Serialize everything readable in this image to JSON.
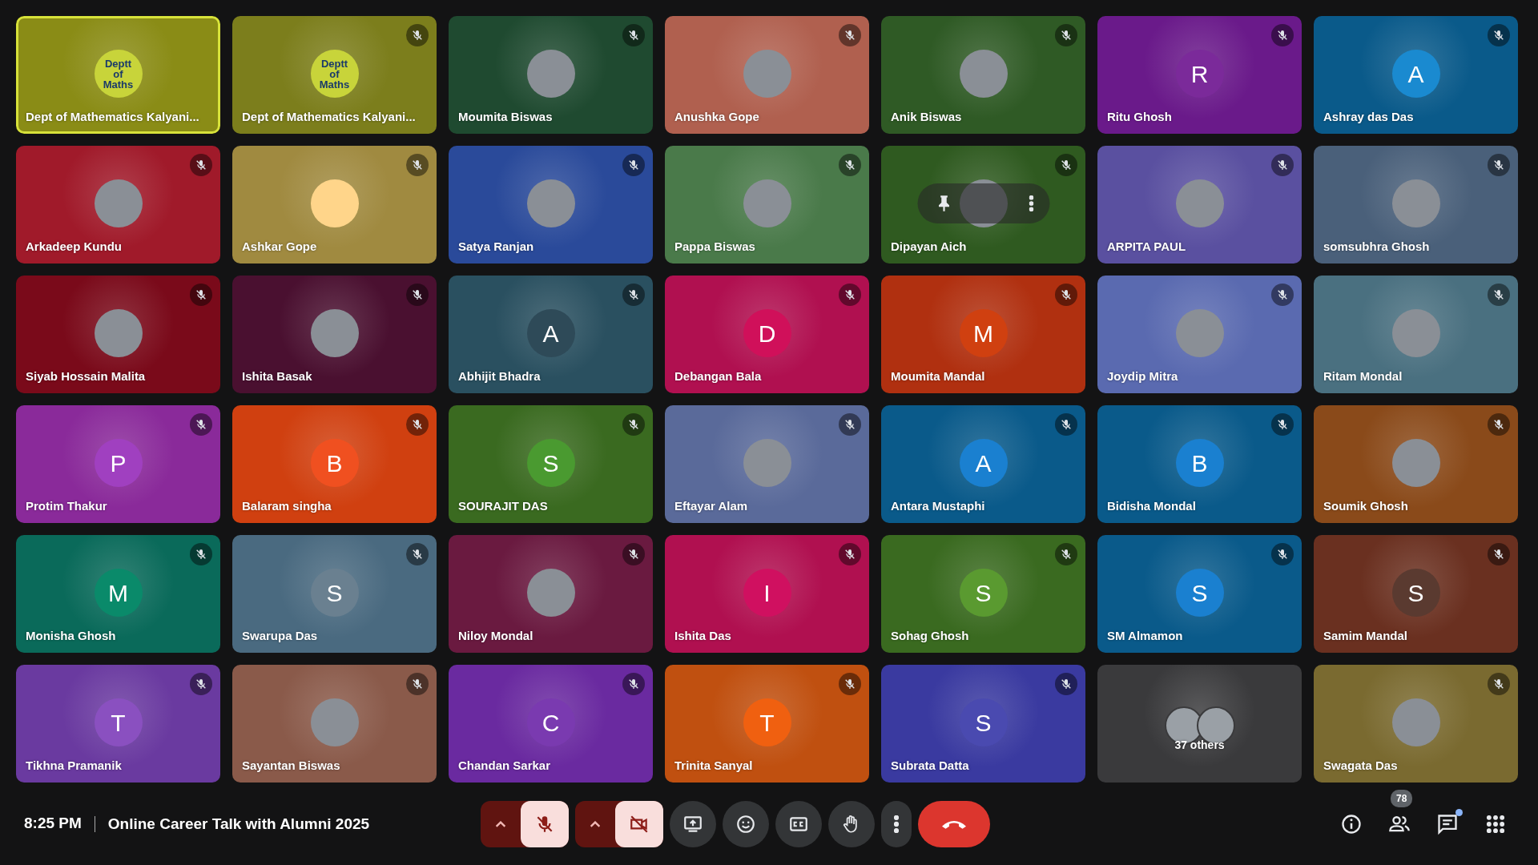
{
  "tiles": [
    {
      "name": "Dept of Mathematics Kalyani...",
      "color": "#8a8c16",
      "avatar": {
        "kind": "logo",
        "text": "Deptt of Maths"
      },
      "muted": false,
      "speaking": true
    },
    {
      "name": "Dept of Mathematics Kalyani...",
      "color": "#7c7e1c",
      "avatar": {
        "kind": "logo",
        "text": "Deptt of Maths"
      },
      "muted": true,
      "speaking": false
    },
    {
      "name": "Moumita Biswas",
      "color": "#1f4a30",
      "avatar": {
        "kind": "photo"
      },
      "muted": true,
      "speaking": false
    },
    {
      "name": "Anushka Gope",
      "color": "#b0604f",
      "avatar": {
        "kind": "photo"
      },
      "muted": true,
      "speaking": false
    },
    {
      "name": "Anik Biswas",
      "color": "#2f5a25",
      "avatar": {
        "kind": "photo"
      },
      "muted": true,
      "speaking": false
    },
    {
      "name": "Ritu Ghosh",
      "color": "#6a1a8a",
      "avatar": {
        "kind": "letter",
        "text": "R",
        "color": "#7b2a9a"
      },
      "muted": true,
      "speaking": false
    },
    {
      "name": "Ashray das Das",
      "color": "#0a5a8a",
      "avatar": {
        "kind": "letter",
        "text": "A",
        "color": "#1a8ad0"
      },
      "muted": true,
      "speaking": false
    },
    {
      "name": "Arkadeep Kundu",
      "color": "#a01a2a",
      "avatar": {
        "kind": "photo"
      },
      "muted": true,
      "speaking": false
    },
    {
      "name": "Ashkar Gope",
      "color": "#a08a40",
      "avatar": {
        "kind": "blank",
        "color": "#ffd58a"
      },
      "muted": true,
      "speaking": false
    },
    {
      "name": "Satya Ranjan",
      "color": "#2a4a9a",
      "avatar": {
        "kind": "photo"
      },
      "muted": true,
      "speaking": false
    },
    {
      "name": "Pappa Biswas",
      "color": "#4a7a4a",
      "avatar": {
        "kind": "photo"
      },
      "muted": true,
      "speaking": false
    },
    {
      "name": "Dipayan Aich",
      "color": "#2f5a20",
      "avatar": {
        "kind": "photo"
      },
      "muted": true,
      "speaking": false,
      "hovered": true
    },
    {
      "name": "ARPITA PAUL",
      "color": "#5a50a0",
      "avatar": {
        "kind": "photo"
      },
      "muted": true,
      "speaking": false
    },
    {
      "name": "somsubhra Ghosh",
      "color": "#4a607a",
      "avatar": {
        "kind": "photo"
      },
      "muted": true,
      "speaking": false
    },
    {
      "name": "Siyab Hossain Malita",
      "color": "#7a0a1a",
      "avatar": {
        "kind": "photo"
      },
      "muted": true,
      "speaking": false
    },
    {
      "name": "Ishita Basak",
      "color": "#4a1030",
      "avatar": {
        "kind": "photo"
      },
      "muted": true,
      "speaking": false
    },
    {
      "name": "Abhijit Bhadra",
      "color": "#2a5060",
      "avatar": {
        "kind": "letter",
        "text": "A",
        "color": "#2e4a58"
      },
      "muted": true,
      "speaking": false
    },
    {
      "name": "Debangan Bala",
      "color": "#b01050",
      "avatar": {
        "kind": "letter",
        "text": "D",
        "color": "#d0105a"
      },
      "muted": true,
      "speaking": false
    },
    {
      "name": "Moumita Mandal",
      "color": "#b03010",
      "avatar": {
        "kind": "letter",
        "text": "M",
        "color": "#d04010"
      },
      "muted": true,
      "speaking": false
    },
    {
      "name": "Joydip Mitra",
      "color": "#5a6ab0",
      "avatar": {
        "kind": "photo"
      },
      "muted": true,
      "speaking": false
    },
    {
      "name": "Ritam Mondal",
      "color": "#4a7080",
      "avatar": {
        "kind": "photo"
      },
      "muted": true,
      "speaking": false
    },
    {
      "name": "Protim Thakur",
      "color": "#8a2a9a",
      "avatar": {
        "kind": "letter",
        "text": "P",
        "color": "#a040c0"
      },
      "muted": true,
      "speaking": false
    },
    {
      "name": "Balaram singha",
      "color": "#d04010",
      "avatar": {
        "kind": "letter",
        "text": "B",
        "color": "#f05020"
      },
      "muted": true,
      "speaking": false
    },
    {
      "name": "SOURAJIT DAS",
      "color": "#3a6a20",
      "avatar": {
        "kind": "letter",
        "text": "S",
        "color": "#4a9a30"
      },
      "muted": true,
      "speaking": false
    },
    {
      "name": "Eftayar Alam",
      "color": "#5a6a9a",
      "avatar": {
        "kind": "photo"
      },
      "muted": true,
      "speaking": false
    },
    {
      "name": "Antara Mustaphi",
      "color": "#0a5a8a",
      "avatar": {
        "kind": "letter",
        "text": "A",
        "color": "#1a80d0"
      },
      "muted": true,
      "speaking": false
    },
    {
      "name": "Bidisha Mondal",
      "color": "#0a5a8a",
      "avatar": {
        "kind": "letter",
        "text": "B",
        "color": "#1a80d0"
      },
      "muted": true,
      "speaking": false
    },
    {
      "name": "Soumik Ghosh",
      "color": "#8a4a1a",
      "avatar": {
        "kind": "photo"
      },
      "muted": true,
      "speaking": false
    },
    {
      "name": "Monisha Ghosh",
      "color": "#0a6a5a",
      "avatar": {
        "kind": "letter",
        "text": "M",
        "color": "#0a8a6a"
      },
      "muted": true,
      "speaking": false
    },
    {
      "name": "Swarupa Das",
      "color": "#4a6a80",
      "avatar": {
        "kind": "letter",
        "text": "S",
        "color": "#6a8090"
      },
      "muted": true,
      "speaking": false
    },
    {
      "name": "Niloy Mondal",
      "color": "#6a1a40",
      "avatar": {
        "kind": "photo"
      },
      "muted": true,
      "speaking": false
    },
    {
      "name": "Ishita Das",
      "color": "#b01050",
      "avatar": {
        "kind": "letter",
        "text": "I",
        "color": "#d01060"
      },
      "muted": true,
      "speaking": false
    },
    {
      "name": "Sohag Ghosh",
      "color": "#3a6a20",
      "avatar": {
        "kind": "letter",
        "text": "S",
        "color": "#5a9a30"
      },
      "muted": true,
      "speaking": false
    },
    {
      "name": "SM Almamon",
      "color": "#0a5a8a",
      "avatar": {
        "kind": "letter",
        "text": "S",
        "color": "#1a80d0"
      },
      "muted": true,
      "speaking": false
    },
    {
      "name": "Samim Mandal",
      "color": "#6a3020",
      "avatar": {
        "kind": "letter",
        "text": "S",
        "color": "#5a3a30"
      },
      "muted": true,
      "speaking": false
    },
    {
      "name": "Tikhna Pramanik",
      "color": "#6a3aa0",
      "avatar": {
        "kind": "letter",
        "text": "T",
        "color": "#8a50c0"
      },
      "muted": true,
      "speaking": false
    },
    {
      "name": "Sayantan Biswas",
      "color": "#8a5a4a",
      "avatar": {
        "kind": "photo"
      },
      "muted": true,
      "speaking": false
    },
    {
      "name": "Chandan Sarkar",
      "color": "#6a2aa0",
      "avatar": {
        "kind": "letter",
        "text": "C",
        "color": "#7a3ab0"
      },
      "muted": true,
      "speaking": false
    },
    {
      "name": "Trinita Sanyal",
      "color": "#c05010",
      "avatar": {
        "kind": "letter",
        "text": "T",
        "color": "#f06010"
      },
      "muted": true,
      "speaking": false
    },
    {
      "name": "Subrata Datta",
      "color": "#3a3aa0",
      "avatar": {
        "kind": "letter",
        "text": "S",
        "color": "#4a4ab0"
      },
      "muted": true,
      "speaking": false
    },
    {
      "name": "37 others",
      "color": "#3a3a3c",
      "avatar": {
        "kind": "group"
      },
      "muted": false,
      "speaking": false
    },
    {
      "name": "Swagata Das",
      "color": "#7a6a30",
      "avatar": {
        "kind": "photo"
      },
      "muted": true,
      "speaking": false
    }
  ],
  "bottom_bar": {
    "time": "8:25 PM",
    "meeting_title": "Online Career Talk with Alumni 2025",
    "controls": [
      {
        "kind": "mic",
        "on": false
      },
      {
        "kind": "camera",
        "on": false
      },
      {
        "kind": "present"
      },
      {
        "kind": "emoji"
      },
      {
        "kind": "captions"
      },
      {
        "kind": "hand"
      },
      {
        "kind": "more"
      },
      {
        "kind": "end"
      }
    ],
    "side": [
      {
        "kind": "info"
      },
      {
        "kind": "people",
        "badge": "78"
      },
      {
        "kind": "chat",
        "dot": true
      },
      {
        "kind": "apps"
      }
    ]
  }
}
